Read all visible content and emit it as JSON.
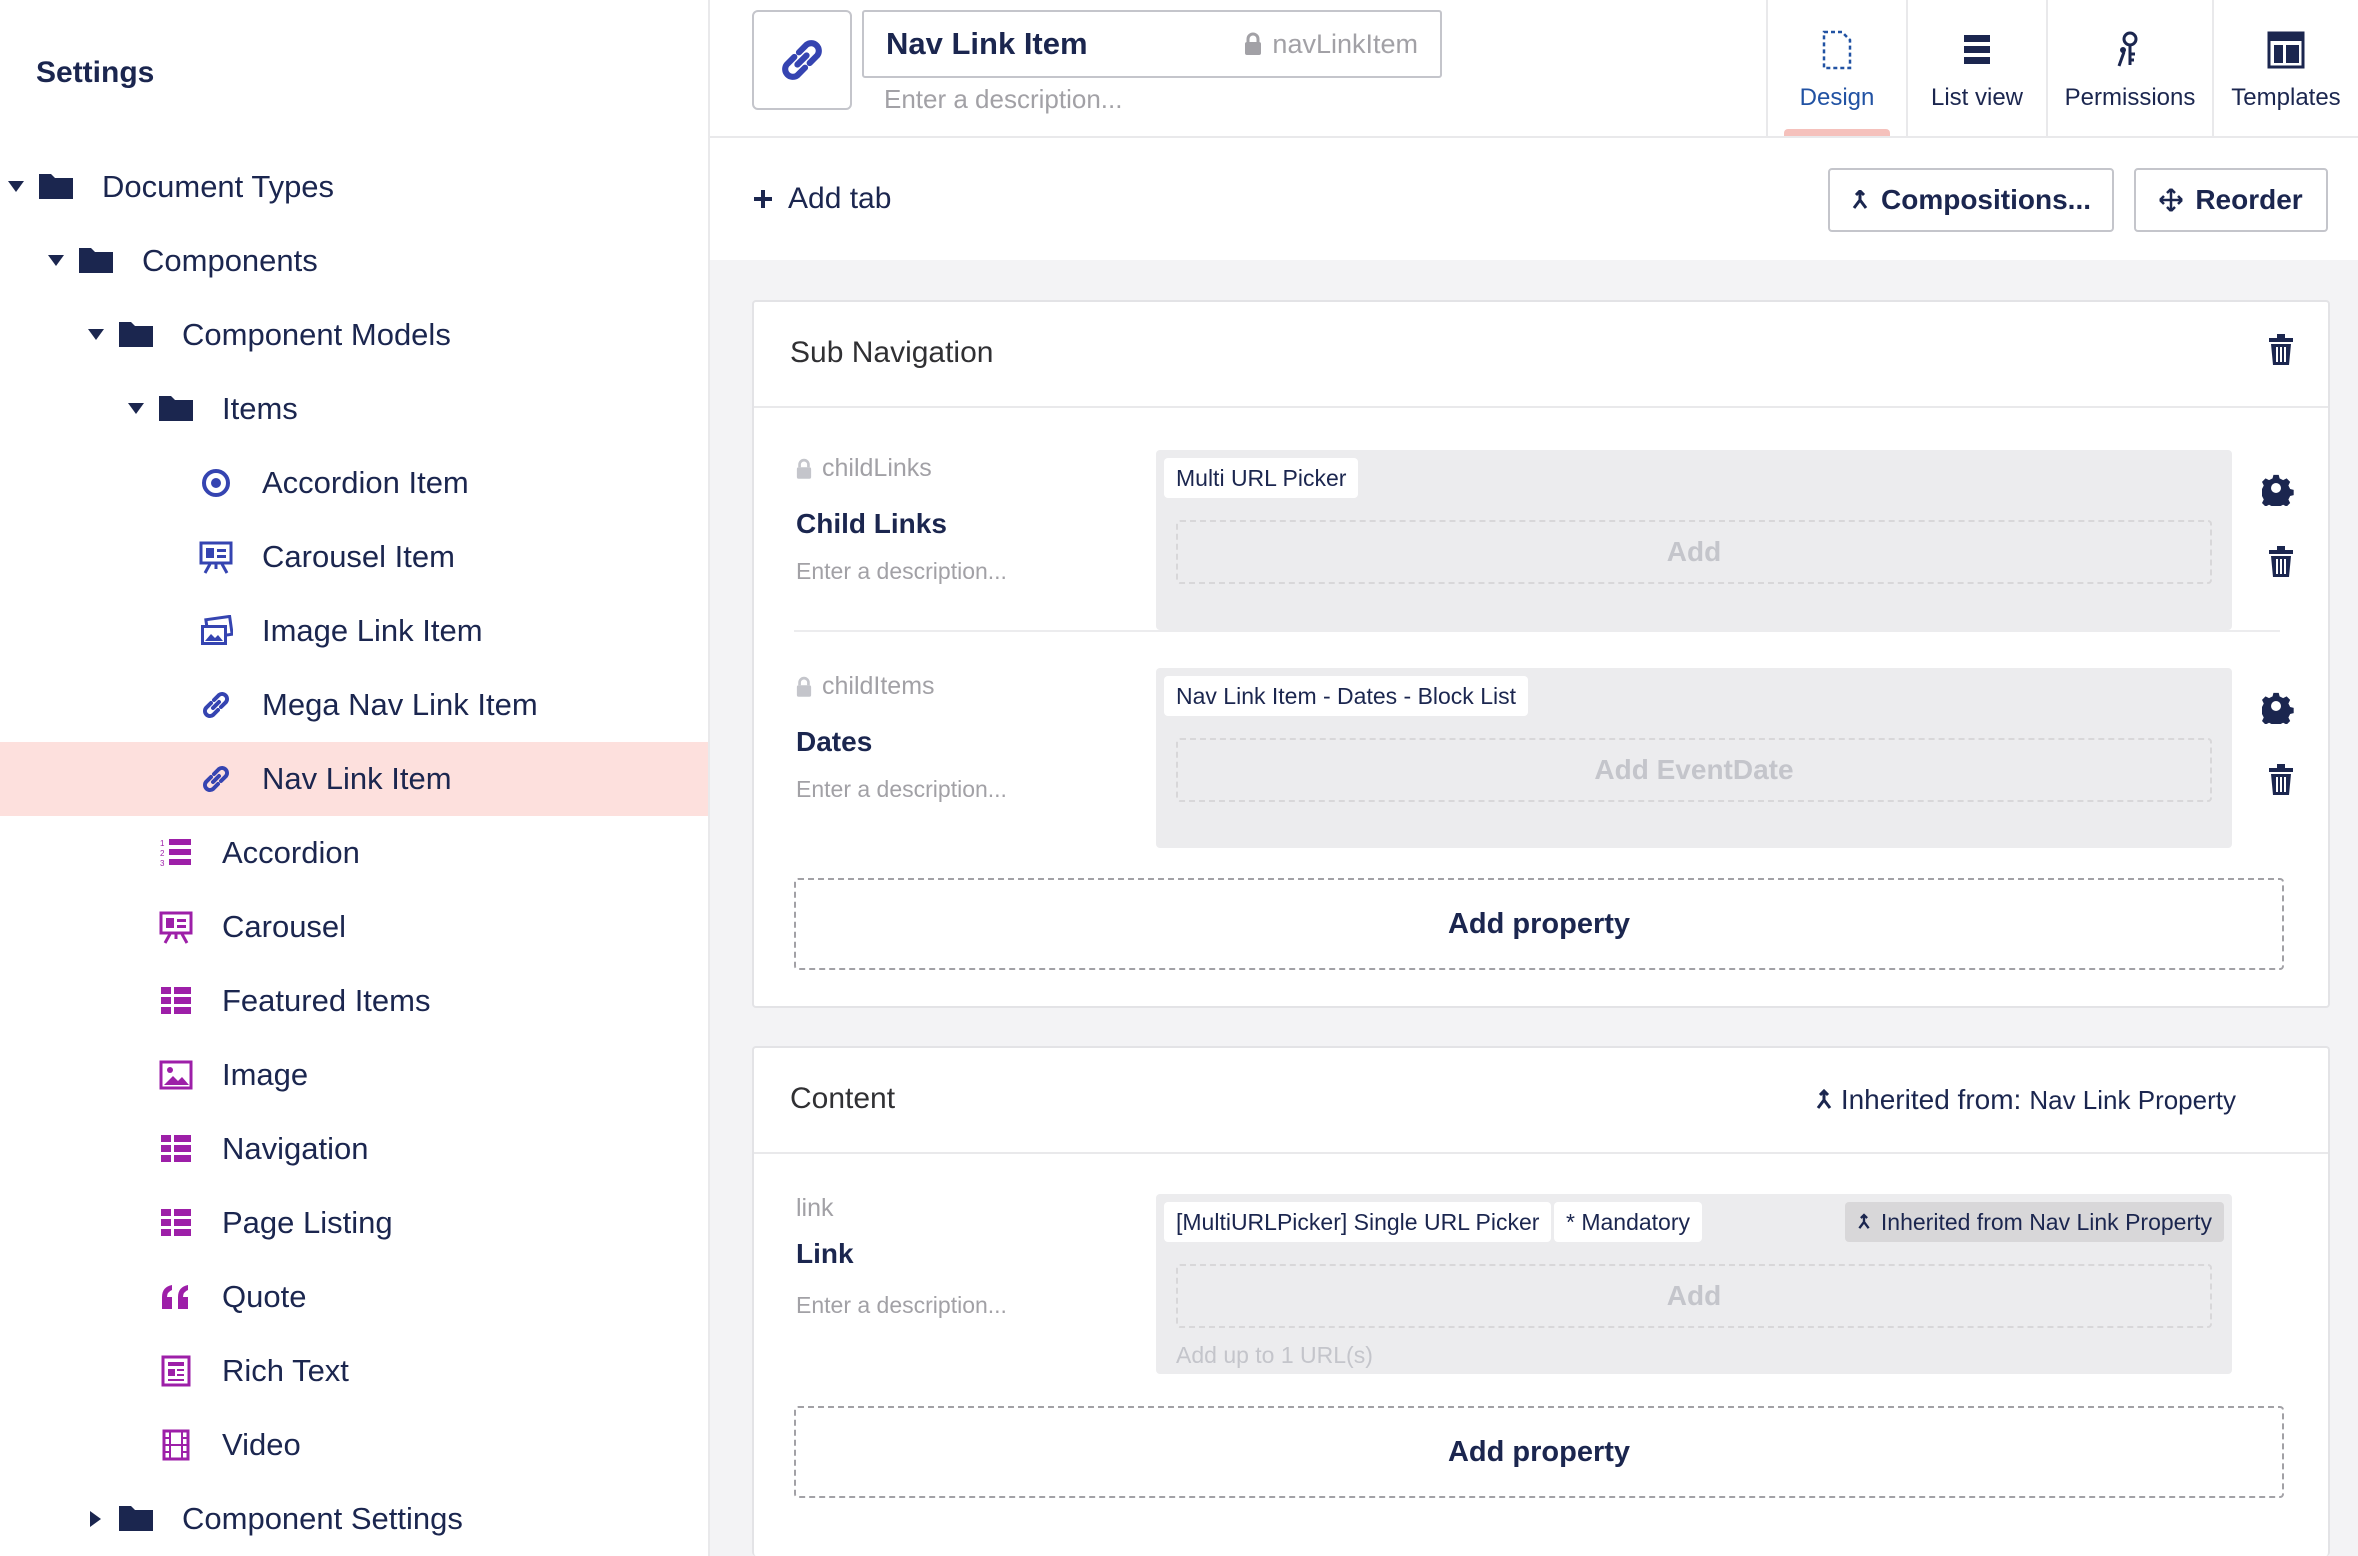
{
  "sidebar": {
    "title": "Settings",
    "tree": [
      {
        "label": "Document Types",
        "icon": "folder-icon",
        "caret": "down",
        "level": 0
      },
      {
        "label": "Components",
        "icon": "folder-icon",
        "caret": "down",
        "level": 1
      },
      {
        "label": "Component Models",
        "icon": "folder-icon",
        "caret": "down",
        "level": 2
      },
      {
        "label": "Items",
        "icon": "folder-icon",
        "caret": "down",
        "level": 3
      },
      {
        "label": "Accordion Item",
        "icon": "target-icon",
        "level": 4
      },
      {
        "label": "Carousel Item",
        "icon": "presentation-icon",
        "level": 4
      },
      {
        "label": "Image Link Item",
        "icon": "pictures-icon",
        "level": 4
      },
      {
        "label": "Mega Nav Link Item",
        "icon": "link-icon",
        "level": 4
      },
      {
        "label": "Nav Link Item",
        "icon": "link-icon",
        "level": 4,
        "active": true
      },
      {
        "label": "Accordion",
        "icon": "ordered-list-icon",
        "level": 3
      },
      {
        "label": "Carousel",
        "icon": "presentation-icon",
        "level": 3
      },
      {
        "label": "Featured Items",
        "icon": "grid-list-icon",
        "level": 3
      },
      {
        "label": "Image",
        "icon": "picture-icon",
        "level": 3
      },
      {
        "label": "Navigation",
        "icon": "grid-list-icon",
        "level": 3
      },
      {
        "label": "Page Listing",
        "icon": "grid-list-icon",
        "level": 3
      },
      {
        "label": "Quote",
        "icon": "quote-icon",
        "level": 3
      },
      {
        "label": "Rich Text",
        "icon": "article-icon",
        "level": 3
      },
      {
        "label": "Video",
        "icon": "film-icon",
        "level": 3
      },
      {
        "label": "Component Settings",
        "icon": "folder-icon",
        "caret": "right",
        "level": 2
      }
    ]
  },
  "header": {
    "icon": "link-icon",
    "name": "Nav Link Item",
    "alias": "navLinkItem",
    "description_placeholder": "Enter a description...",
    "views": [
      {
        "label": "Design",
        "icon": "document-icon",
        "active": true
      },
      {
        "label": "List view",
        "icon": "list-icon"
      },
      {
        "label": "Permissions",
        "icon": "keys-icon"
      },
      {
        "label": "Templates",
        "icon": "layout-icon"
      }
    ]
  },
  "toolbar": {
    "add_tab": "Add tab",
    "compositions": "Compositions...",
    "reorder": "Reorder"
  },
  "groups": [
    {
      "title": "Sub Navigation",
      "properties": [
        {
          "alias": "childLinks",
          "locked": true,
          "name": "Child Links",
          "description": "Enter a description...",
          "editor_tag": "Multi URL Picker",
          "add_label": "Add"
        },
        {
          "alias": "childItems",
          "locked": true,
          "name": "Dates",
          "description": "Enter a description...",
          "editor_tag": "Nav Link Item - Dates - Block List",
          "add_label": "Add EventDate"
        }
      ],
      "add_property": "Add property"
    },
    {
      "title": "Content",
      "inherited_prefix": "Inherited from:",
      "inherited_name": "Nav Link Property",
      "properties": [
        {
          "alias": "link",
          "locked": false,
          "name": "Link",
          "description": "Enter a description...",
          "editor_tag": "[MultiURLPicker] Single URL Picker",
          "mandatory_tag": "* Mandatory",
          "inherited_tag": "Inherited from Nav Link Property",
          "add_label": "Add",
          "hint": "Add up to 1 URL(s)"
        }
      ],
      "add_property": "Add property"
    }
  ],
  "colors": {
    "navy": "#1b264f",
    "purple": "#9d1fa8",
    "link_blue": "#3544b1",
    "active_row": "#fde0dd",
    "tab_underline": "#f5c1bc"
  }
}
